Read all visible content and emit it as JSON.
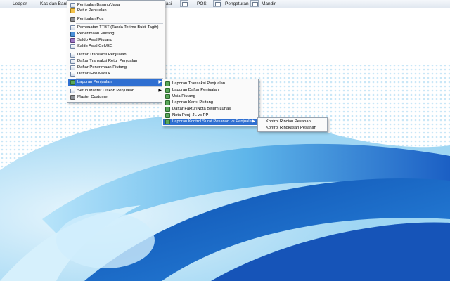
{
  "toolbar": {
    "items": [
      {
        "label": "Ledger"
      },
      {
        "label": "Kas dan Bank"
      },
      {
        "label": "asi"
      },
      {
        "label": "POS"
      },
      {
        "label": "Pengaturan"
      },
      {
        "label": "Mandiri"
      }
    ]
  },
  "menu_penjualan": {
    "items": [
      {
        "label": "Penjualan Barang/Jasa",
        "icon": "sales-document-icon"
      },
      {
        "label": "Retur Penjualan",
        "icon": "return-icon"
      },
      {
        "label": "Penjualan Pos",
        "icon": "pos-icon"
      },
      {
        "label": "Pembuatan TTBT (Tanda Terima Bukti Tagih)",
        "icon": "receipt-icon"
      },
      {
        "label": "Penerimaan Piutang",
        "icon": "receivable-icon"
      },
      {
        "label": "Saldo Awal Piutang",
        "icon": "balance-icon"
      },
      {
        "label": "Saldo Awal Cek/BG",
        "icon": "check-icon"
      },
      {
        "label": "Daftar Transaksi Penjualan",
        "icon": "list-icon"
      },
      {
        "label": "Daftar Transaksi Retur Penjualan",
        "icon": "list-icon"
      },
      {
        "label": "Daftar Penerimaan Piutang",
        "icon": "list-icon"
      },
      {
        "label": "Daftar Giro Masuk",
        "icon": "list-icon"
      },
      {
        "label": "Laporan Penjualan",
        "icon": "report-icon",
        "submenu": true
      },
      {
        "label": "Setup Master Diskon Penjualan",
        "icon": "setup-icon",
        "submenu": true
      },
      {
        "label": "Master Custumer",
        "icon": "customer-icon"
      }
    ]
  },
  "menu_laporan": {
    "items": [
      {
        "label": "Laporan Transaksi Penjualan"
      },
      {
        "label": "Laporan Daftar Penjualan"
      },
      {
        "label": "Usia Piutang"
      },
      {
        "label": "Laporan Kartu Piutang"
      },
      {
        "label": "Daftar Faktur/Nota Belum Lunas"
      },
      {
        "label": "Nota Penj. JL vs PP"
      },
      {
        "label": "Laporan Kontrol Surat Pesanan vs Penjualan",
        "submenu": true
      }
    ]
  },
  "menu_kontrol": {
    "items": [
      {
        "label": "Kontrol Rincian Pesanan"
      },
      {
        "label": "Kontrol Ringkasan Pesanan"
      }
    ]
  },
  "arrow_glyph": "▶",
  "colors": {
    "highlight": "#2f6fd1",
    "swoosh_dark": "#1b5fc4",
    "swoosh_light": "#8fd0f4"
  }
}
